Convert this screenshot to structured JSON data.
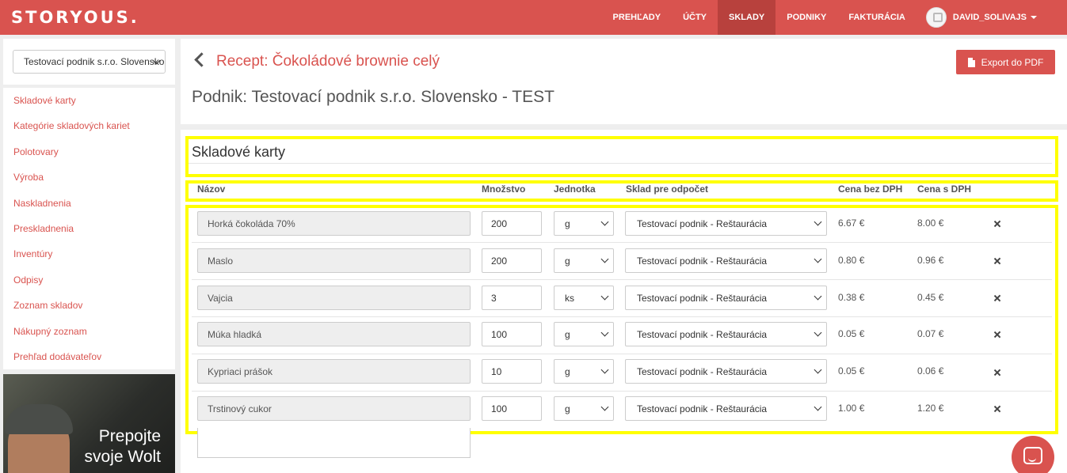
{
  "brand": {
    "logo": "STORYOUS."
  },
  "nav": {
    "items": [
      "PREHĽADY",
      "ÚČTY",
      "SKLADY",
      "PODNIKY",
      "FAKTURÁCIA"
    ],
    "active": "SKLADY",
    "user": "DAVID_SOLIVAJS"
  },
  "sidebar": {
    "business_select": "Testovací podnik s.r.o. Slovensko - TEST",
    "items": [
      {
        "label": "Skladové karty"
      },
      {
        "label": "Kategórie skladových kariet"
      },
      {
        "label": "Polotovary"
      },
      {
        "label": "Výroba"
      },
      {
        "label": "Naskladnenia"
      },
      {
        "label": "Preskladnenia"
      },
      {
        "label": "Inventúry"
      },
      {
        "label": "Odpisy"
      },
      {
        "label": "Zoznam skladov"
      },
      {
        "label": "Nákupný zoznam"
      },
      {
        "label": "Prehľad dodávateľov"
      }
    ],
    "ad_text": [
      "Prepojte",
      "svoje Wolt"
    ]
  },
  "header": {
    "recipe_title": "Recept: Čokoládové brownie celý",
    "export_label": "Export do PDF",
    "business_title": "Podnik: Testovací podnik s.r.o. Slovensko - TEST"
  },
  "card": {
    "title": "Skladové karty",
    "columns": {
      "name": "Názov",
      "quantity": "Množstvo",
      "unit": "Jednotka",
      "store": "Sklad pre odpočet",
      "price_net": "Cena bez DPH",
      "price_gross": "Cena s DPH"
    },
    "rows": [
      {
        "name": "Horká čokoláda 70%",
        "qty": "200",
        "unit": "g",
        "store": "Testovací podnik - Reštaurácia",
        "net": "6.67 €",
        "gross": "8.00 €"
      },
      {
        "name": "Maslo",
        "qty": "200",
        "unit": "g",
        "store": "Testovací podnik - Reštaurácia",
        "net": "0.80 €",
        "gross": "0.96 €"
      },
      {
        "name": "Vajcia",
        "qty": "3",
        "unit": "ks",
        "store": "Testovací podnik - Reštaurácia",
        "net": "0.38 €",
        "gross": "0.45 €"
      },
      {
        "name": "Múka hladká",
        "qty": "100",
        "unit": "g",
        "store": "Testovací podnik - Reštaurácia",
        "net": "0.05 €",
        "gross": "0.07 €"
      },
      {
        "name": "Kypriaci prášok",
        "qty": "10",
        "unit": "g",
        "store": "Testovací podnik - Reštaurácia",
        "net": "0.05 €",
        "gross": "0.06 €"
      },
      {
        "name": "Trstinový cukor",
        "qty": "100",
        "unit": "g",
        "store": "Testovací podnik - Reštaurácia",
        "net": "1.00 €",
        "gross": "1.20 €"
      }
    ]
  },
  "colors": {
    "brand": "#d9534f",
    "highlight": "#ffff00"
  }
}
